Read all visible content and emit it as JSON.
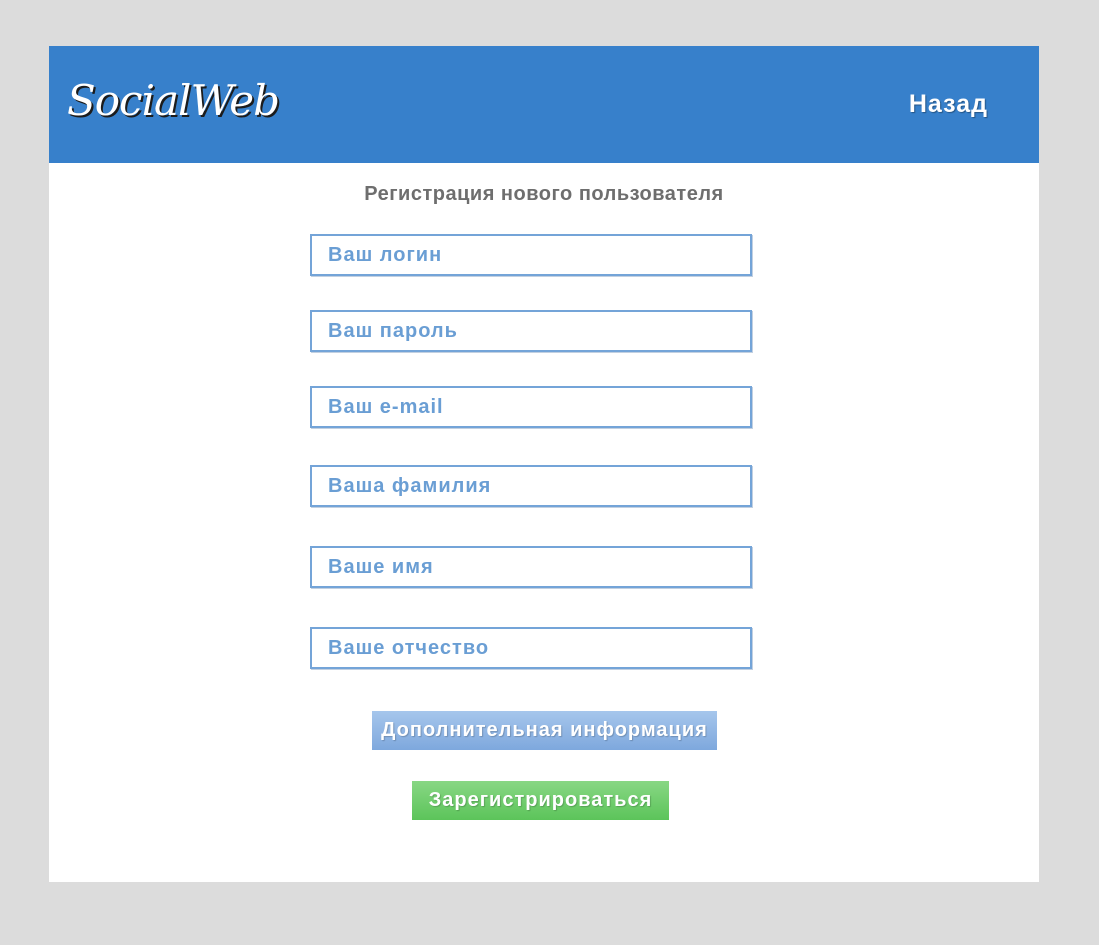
{
  "header": {
    "logo_text": "SocialWeb",
    "back_label": "Назад"
  },
  "form": {
    "title": "Регистрация нового пользователя",
    "fields": [
      {
        "placeholder": "Ваш логин",
        "value": ""
      },
      {
        "placeholder": "Ваш пароль",
        "value": ""
      },
      {
        "placeholder": "Ваш e-mail",
        "value": ""
      },
      {
        "placeholder": "Ваша фамилия",
        "value": ""
      },
      {
        "placeholder": "Ваше имя",
        "value": ""
      },
      {
        "placeholder": "Ваше отчество",
        "value": ""
      }
    ],
    "more_info_label": "Дополнительная информация",
    "register_label": "Зарегистрироваться"
  },
  "colors": {
    "header_bg": "#3780cb",
    "field_border": "#74a4d8",
    "more_info_button": "#8db4e4",
    "register_button": "#6acb67",
    "page_bg": "#dcdcdc"
  }
}
